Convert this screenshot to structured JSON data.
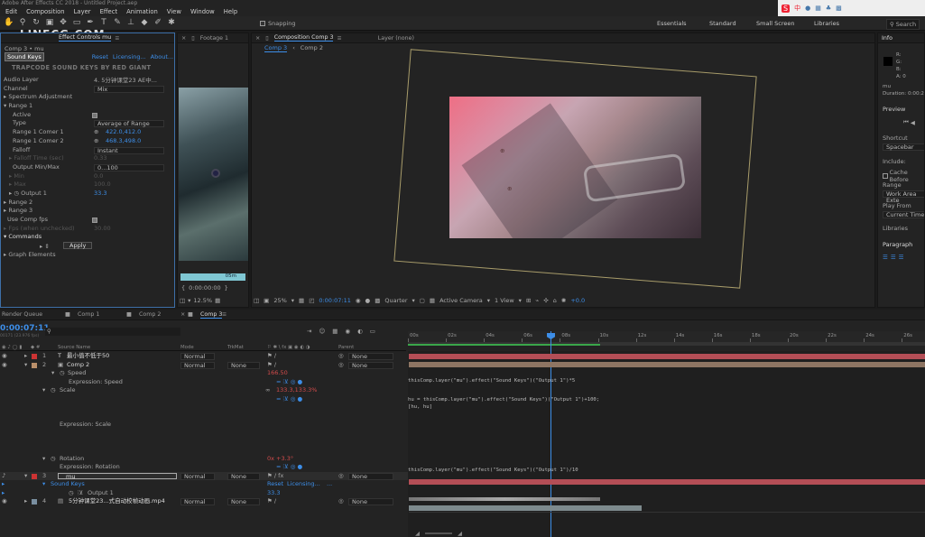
{
  "app": {
    "title": "Adobe After Effects CC 2018 - Untitled Project.aep",
    "logo": "LINECG.COM"
  },
  "menus": [
    "Edit",
    "Composition",
    "Layer",
    "Effect",
    "Animation",
    "View",
    "Window",
    "Help"
  ],
  "toolbar": {
    "snapping": "Snapping",
    "workspaces": [
      "Essentials",
      "Standard",
      "Small Screen",
      "Libraries"
    ],
    "search": "Search"
  },
  "effect_controls": {
    "tab": "Effect Controls mu",
    "breadcrumb": "Comp 3 • mu",
    "effect_name": "Sound Keys",
    "reset": "Reset",
    "licensing": "Licensing...",
    "about": "About...",
    "banner": "TRAPCODE SOUND KEYS BY RED GIANT",
    "rows": [
      {
        "label": "Audio Layer",
        "value": "4. 5分钟课堂23 AE中..."
      },
      {
        "label": "Channel",
        "value": "Mix"
      },
      {
        "label": "Spectrum Adjustment",
        "value": ""
      },
      {
        "label": "Range 1",
        "value": ""
      },
      {
        "label": "Active",
        "value": ""
      },
      {
        "label": "Type",
        "value": "Average of Range"
      },
      {
        "label": "Range 1 Comer 1",
        "value": "422.0,412.0"
      },
      {
        "label": "Range 1 Comer 2",
        "value": "468.3,498.0"
      },
      {
        "label": "Falloff",
        "value": "Instant"
      },
      {
        "label": "Falloff Time (sec)",
        "value": "0.33"
      },
      {
        "label": "Output Min/Max",
        "value": "0...100"
      },
      {
        "label": "Min",
        "value": "0.0"
      },
      {
        "label": "Max",
        "value": "100.0"
      },
      {
        "label": "Output 1",
        "value": "33.3"
      },
      {
        "label": "Range 2",
        "value": ""
      },
      {
        "label": "Range 3",
        "value": ""
      },
      {
        "label": "Use Comp fps",
        "value": ""
      },
      {
        "label": "Fps (when unchecked)",
        "value": "30.00"
      },
      {
        "label": "Commands",
        "value": ""
      },
      {
        "label": "",
        "value": "Apply"
      },
      {
        "label": "Graph Elements",
        "value": ""
      }
    ]
  },
  "footage": {
    "tab": "Footage 1",
    "time": "0:00:00:00",
    "bar": "05m"
  },
  "composition": {
    "tab": "Composition Comp 3",
    "layer_tab": "Layer (none)",
    "subtabs": [
      "Comp 3",
      "Comp 2"
    ],
    "bottom": {
      "zoom": "12.5%",
      "zoom2": "25%",
      "time": "0:00:07:11",
      "quality": "Quarter",
      "camera": "Active Camera",
      "view": "1 View",
      "exposure": "+0.0"
    }
  },
  "info": {
    "tab": "Info",
    "r": "R:",
    "g": "G:",
    "b": "B:",
    "a": "A: 0",
    "name": "mu",
    "duration": "Duration: 0:00:2",
    "preview": "Preview",
    "shortcut": "Shortcut",
    "spacebar": "Spacebar",
    "include": "Include:",
    "cache": "Cache Before",
    "range": "Range",
    "range_val": "Work Area Exte",
    "play_from": "Play From",
    "play_val": "Current Time",
    "libraries": "Libraries",
    "paragraph": "Paragraph"
  },
  "timeline": {
    "tabs": [
      "Render Queue",
      "Comp 1",
      "Comp 2",
      "Comp 3"
    ],
    "time": "0:00:07:11",
    "fps": "00171 (23.976 fps)",
    "cols": {
      "source": "Source Name",
      "mode": "Mode",
      "trkmat": "TrkMat",
      "parent": "Parent"
    },
    "ruler": [
      "00s",
      "02s",
      "04s",
      "06s",
      "08s",
      "10s",
      "12s",
      "14s",
      "16s",
      "18s",
      "20s",
      "22s",
      "24s",
      "26s"
    ],
    "rows": [
      {
        "num": "1",
        "name": "最小值不低于50",
        "mode": "Normal",
        "trk": "",
        "parent": "None"
      },
      {
        "num": "2",
        "name": "Comp 2",
        "mode": "Normal",
        "trk": "None",
        "parent": "None"
      },
      {
        "name": "Speed",
        "value": "166.50"
      },
      {
        "name": "Expression: Speed"
      },
      {
        "name": "Scale",
        "value": "133.3,133.3%"
      },
      {
        "name": "Expression: Scale"
      },
      {
        "name": "Rotation",
        "value": "0x +3.3°"
      },
      {
        "name": "Expression: Rotation"
      },
      {
        "num": "3",
        "name": "mu",
        "mode": "Normal",
        "trk": "None",
        "parent": "None"
      },
      {
        "name": "Sound Keys",
        "reset": "Reset",
        "licensing": "Licensing...",
        "more": "..."
      },
      {
        "name": "Output 1",
        "value": "33.3"
      },
      {
        "num": "4",
        "name": "5分钟课堂23...式自动校帧动画.mp4",
        "mode": "Normal",
        "trk": "None",
        "parent": "None"
      }
    ],
    "expressions": {
      "speed": "thisComp.layer(\"mu\").effect(\"Sound Keys\")(\"Output 1\")*5",
      "scale1": "hu = thisComp.layer(\"mu\").effect(\"Sound Keys\")(\"Output 1\")+100;",
      "scale2": "[hu, hu]",
      "rotation": "thisComp.layer(\"mu\").effect(\"Sound Keys\")(\"Output 1\")/10"
    }
  }
}
